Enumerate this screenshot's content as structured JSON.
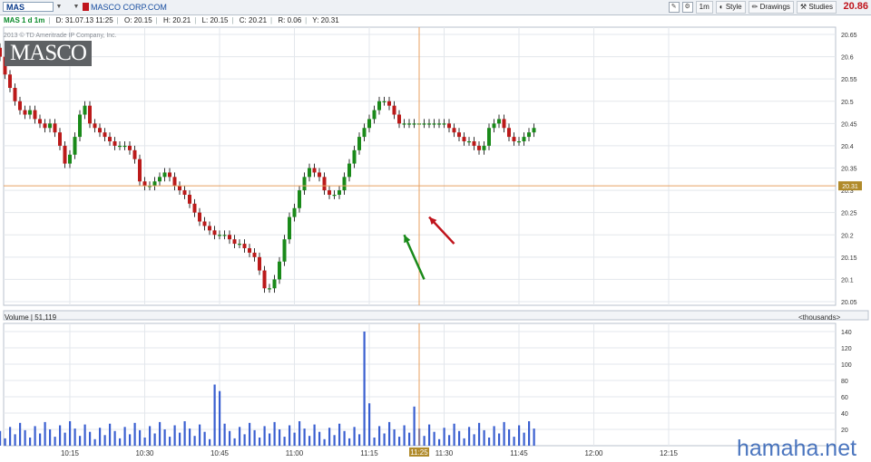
{
  "toolbar": {
    "symbol": "MAS",
    "company": "MASCO CORP.COM",
    "timeframe": "1m",
    "style_label": "Style",
    "drawings_label": "Drawings",
    "studies_label": "Studies",
    "last_price": "20.86"
  },
  "info": {
    "title": "MAS 1 d 1m",
    "date": "D: 31.07.13 11:25",
    "open": "O: 20.15",
    "high": "H: 20.21",
    "low": "L: 20.15",
    "close": "C: 20.21",
    "range": "R: 0.06",
    "y": "Y: 20.31"
  },
  "logo_text": "MASCO",
  "copyright": "2013 © TD Ameritrade IP Company, Inc.",
  "volume_panel": {
    "label": "Volume",
    "value": "51,119",
    "unit": "<thousands>"
  },
  "watermark": "hamaha.net",
  "colors": {
    "up": "#1a8a1a",
    "down": "#bb1a1a",
    "volume": "#3a5fd0",
    "crosshair": "#e8a060",
    "price_tag": "#b08a2a",
    "arrow_green": "#1a8a1a",
    "arrow_red": "#c0141c"
  },
  "chart_data": {
    "type": "candlestick",
    "interval": "1m",
    "price_ylim": [
      20.05,
      20.65
    ],
    "price_ticks": [
      "20.65",
      "20.6",
      "20.55",
      "20.5",
      "20.45",
      "20.4",
      "20.35",
      "20.3",
      "20.25",
      "20.2",
      "20.15",
      "20.1",
      "20.05"
    ],
    "price_tick_values": [
      20.65,
      20.6,
      20.55,
      20.5,
      20.45,
      20.4,
      20.35,
      20.3,
      20.25,
      20.2,
      20.15,
      20.1,
      20.05
    ],
    "volume_ylim": [
      0,
      150
    ],
    "volume_ticks": [
      "140",
      "120",
      "100",
      "80",
      "60",
      "40",
      "20"
    ],
    "volume_tick_values": [
      140,
      120,
      100,
      80,
      60,
      40,
      20
    ],
    "time_ticks": [
      "10:15",
      "10:30",
      "10:45",
      "11:00",
      "11:15",
      "11:30",
      "11:45",
      "12:00",
      "12:15"
    ],
    "time_tick_minutes": [
      15,
      30,
      45,
      60,
      75,
      90,
      105,
      120,
      135
    ],
    "crosshair": {
      "label": "11:25",
      "minute": 85,
      "price": "20.31",
      "price_value": 20.31
    },
    "close_path": [
      [
        0,
        20.62
      ],
      [
        1,
        20.63
      ],
      [
        2,
        20.64
      ],
      [
        3,
        20.62
      ],
      [
        4,
        20.6
      ],
      [
        5,
        20.56
      ],
      [
        6,
        20.53
      ],
      [
        7,
        20.5
      ],
      [
        8,
        20.48
      ],
      [
        9,
        20.47
      ],
      [
        10,
        20.48
      ],
      [
        11,
        20.46
      ],
      [
        12,
        20.45
      ],
      [
        13,
        20.44
      ],
      [
        14,
        20.45
      ],
      [
        15,
        20.43
      ],
      [
        16,
        20.4
      ],
      [
        17,
        20.36
      ],
      [
        18,
        20.38
      ],
      [
        19,
        20.42
      ],
      [
        20,
        20.47
      ],
      [
        21,
        20.49
      ],
      [
        22,
        20.45
      ],
      [
        23,
        20.44
      ],
      [
        24,
        20.43
      ],
      [
        25,
        20.42
      ],
      [
        26,
        20.41
      ],
      [
        27,
        20.4
      ],
      [
        28,
        20.4
      ],
      [
        29,
        20.4
      ],
      [
        30,
        20.39
      ],
      [
        31,
        20.37
      ],
      [
        32,
        20.32
      ],
      [
        33,
        20.31
      ],
      [
        34,
        20.31
      ],
      [
        35,
        20.32
      ],
      [
        36,
        20.33
      ],
      [
        37,
        20.34
      ],
      [
        38,
        20.33
      ],
      [
        39,
        20.31
      ],
      [
        40,
        20.3
      ],
      [
        41,
        20.29
      ],
      [
        42,
        20.27
      ],
      [
        43,
        20.25
      ],
      [
        44,
        20.23
      ],
      [
        45,
        20.22
      ],
      [
        46,
        20.21
      ],
      [
        47,
        20.2
      ],
      [
        48,
        20.2
      ],
      [
        49,
        20.2
      ],
      [
        50,
        20.19
      ],
      [
        51,
        20.18
      ],
      [
        52,
        20.18
      ],
      [
        53,
        20.17
      ],
      [
        54,
        20.16
      ],
      [
        55,
        20.15
      ],
      [
        56,
        20.12
      ],
      [
        57,
        20.08
      ],
      [
        58,
        20.08
      ],
      [
        59,
        20.1
      ],
      [
        60,
        20.14
      ],
      [
        61,
        20.19
      ],
      [
        62,
        20.24
      ],
      [
        63,
        20.26
      ],
      [
        64,
        20.3
      ],
      [
        65,
        20.33
      ],
      [
        66,
        20.35
      ],
      [
        67,
        20.34
      ],
      [
        68,
        20.33
      ],
      [
        69,
        20.3
      ],
      [
        70,
        20.29
      ],
      [
        71,
        20.29
      ],
      [
        72,
        20.3
      ],
      [
        73,
        20.33
      ],
      [
        74,
        20.36
      ],
      [
        75,
        20.39
      ],
      [
        76,
        20.42
      ],
      [
        77,
        20.44
      ],
      [
        78,
        20.46
      ],
      [
        79,
        20.48
      ],
      [
        80,
        20.5
      ],
      [
        81,
        20.5
      ],
      [
        82,
        20.49
      ],
      [
        83,
        20.47
      ],
      [
        84,
        20.45
      ],
      [
        85,
        20.45
      ],
      [
        86,
        20.45
      ],
      [
        87,
        20.45
      ],
      [
        88,
        20.45
      ],
      [
        89,
        20.45
      ],
      [
        90,
        20.45
      ],
      [
        91,
        20.45
      ],
      [
        92,
        20.45
      ],
      [
        93,
        20.45
      ],
      [
        94,
        20.44
      ],
      [
        95,
        20.43
      ],
      [
        96,
        20.42
      ],
      [
        97,
        20.41
      ],
      [
        98,
        20.41
      ],
      [
        99,
        20.4
      ],
      [
        100,
        20.39
      ],
      [
        101,
        20.4
      ],
      [
        102,
        20.44
      ],
      [
        103,
        20.45
      ],
      [
        104,
        20.46
      ],
      [
        105,
        20.44
      ],
      [
        106,
        20.42
      ],
      [
        107,
        20.41
      ],
      [
        108,
        20.41
      ],
      [
        109,
        20.42
      ],
      [
        110,
        20.43
      ],
      [
        111,
        20.44
      ]
    ],
    "minute_of_first_candle": -3,
    "volume_spikes": [
      {
        "minute": 74,
        "value": 140
      },
      {
        "minute": 44,
        "value": 75
      },
      {
        "minute": 45,
        "value": 67
      },
      {
        "minute": 75,
        "value": 52
      },
      {
        "minute": 84,
        "value": 48
      }
    ],
    "annotations": [
      {
        "type": "arrow",
        "color": "green",
        "from_minute": 86,
        "from_price": 20.1,
        "to_minute": 82,
        "to_price": 20.2
      },
      {
        "type": "arrow",
        "color": "red",
        "from_minute": 92,
        "from_price": 20.18,
        "to_minute": 87,
        "to_price": 20.24
      }
    ]
  }
}
